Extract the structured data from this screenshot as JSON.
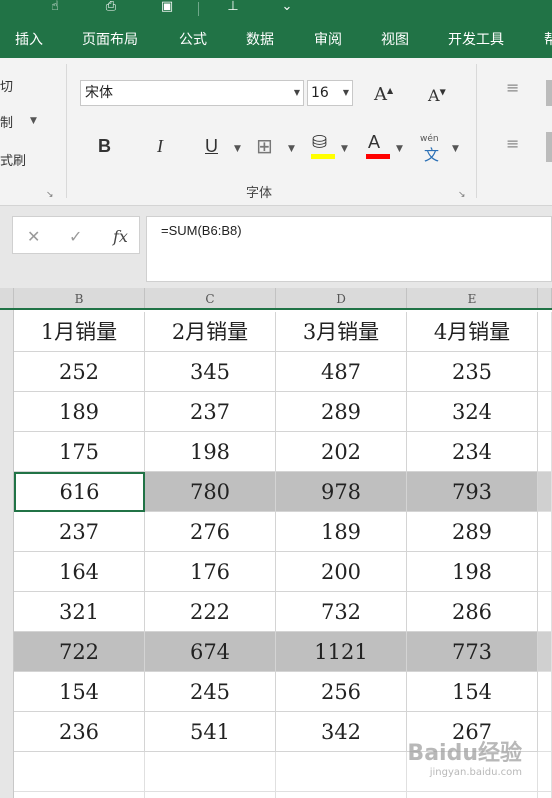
{
  "ribbon_tabs": [
    "插入",
    "页面布局",
    "公式",
    "数据",
    "审阅",
    "视图",
    "开发工具",
    "帮"
  ],
  "clipboard_group": {
    "cut_label": "切",
    "copy_label": "制",
    "format_painter_label": "式刷"
  },
  "font_group": {
    "font_name": "宋体",
    "font_size": "16",
    "bold_label": "B",
    "italic_label": "I",
    "underline_label": "U",
    "grow_font_label": "A",
    "shrink_font_label": "A",
    "font_color_label": "A",
    "phonetic_top": "wén",
    "phonetic_bottom": "文",
    "group_label": "字体",
    "fill_color": "#ffff00",
    "font_color": "#ff0000"
  },
  "formula_bar": {
    "cancel_icon": "✕",
    "enter_icon": "✓",
    "fx_label": "fx",
    "formula": "=SUM(B6:B8)"
  },
  "column_headers": [
    "B",
    "C",
    "D",
    "E"
  ],
  "table": {
    "header_row": [
      "1月销量",
      "2月销量",
      "3月销量",
      "4月销量"
    ],
    "rows": [
      [
        "252",
        "345",
        "487",
        "235"
      ],
      [
        "189",
        "237",
        "289",
        "324"
      ],
      [
        "175",
        "198",
        "202",
        "234"
      ],
      [
        "616",
        "780",
        "978",
        "793"
      ],
      [
        "237",
        "276",
        "189",
        "289"
      ],
      [
        "164",
        "176",
        "200",
        "198"
      ],
      [
        "321",
        "222",
        "732",
        "286"
      ],
      [
        "722",
        "674",
        "1121",
        "773"
      ],
      [
        "154",
        "245",
        "256",
        "154"
      ],
      [
        "236",
        "541",
        "342",
        "267"
      ]
    ],
    "highlighted_rows": [
      3,
      7
    ],
    "active_cell": "B8"
  },
  "watermark": {
    "logo": "Baidu经验",
    "url": "jingyan.baidu.com"
  },
  "colors": {
    "excel_green": "#217346",
    "sum_row_fill": "#bfbfbf"
  }
}
